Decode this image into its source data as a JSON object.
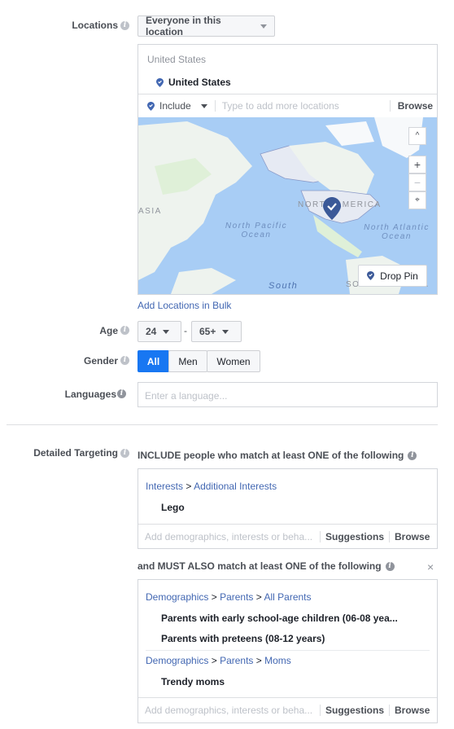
{
  "locations": {
    "label": "Locations",
    "type_dropdown": "Everyone in this location",
    "group_header": "United States",
    "selected": "United States",
    "include_dropdown": "Include",
    "search_placeholder": "Type to add more locations",
    "browse": "Browse",
    "map": {
      "labels": [
        "ASIA",
        "NORTH AMERICA",
        "North Pacific Ocean",
        "North Atlantic Ocean",
        "South",
        "SOUTH AMERICA"
      ],
      "drop_pin": "Drop Pin",
      "zoom_in": "+",
      "zoom_out": "−",
      "collapse": "^"
    },
    "add_bulk": "Add Locations in Bulk"
  },
  "age": {
    "label": "Age",
    "min": "24",
    "separator": "-",
    "max": "65+"
  },
  "gender": {
    "label": "Gender",
    "options": [
      "All",
      "Men",
      "Women"
    ],
    "selected": "All"
  },
  "languages": {
    "label": "Languages",
    "placeholder": "Enter a language..."
  },
  "detailed_targeting": {
    "label": "Detailed Targeting",
    "include_heading": "INCLUDE people who match at least ONE of the following",
    "include_box": {
      "path": [
        "Interests",
        "Additional Interests"
      ],
      "items": [
        "Lego"
      ],
      "placeholder": "Add demographics, interests or beha...",
      "suggestions": "Suggestions",
      "browse": "Browse"
    },
    "must_heading": "and MUST ALSO match at least ONE of the following",
    "close": "×",
    "must_box": {
      "groups": [
        {
          "path": [
            "Demographics",
            "Parents",
            "All Parents"
          ],
          "items": [
            "Parents with early school-age children (06-08 yea...",
            "Parents with preteens (08-12 years)"
          ]
        },
        {
          "path": [
            "Demographics",
            "Parents",
            "Moms"
          ],
          "items": [
            "Trendy moms"
          ]
        }
      ],
      "placeholder": "Add demographics, interests or beha...",
      "suggestions": "Suggestions",
      "browse": "Browse"
    }
  },
  "colors": {
    "accent": "#4267b2",
    "selected_button": "#1877f2",
    "map_water": "#a8cdf5"
  }
}
